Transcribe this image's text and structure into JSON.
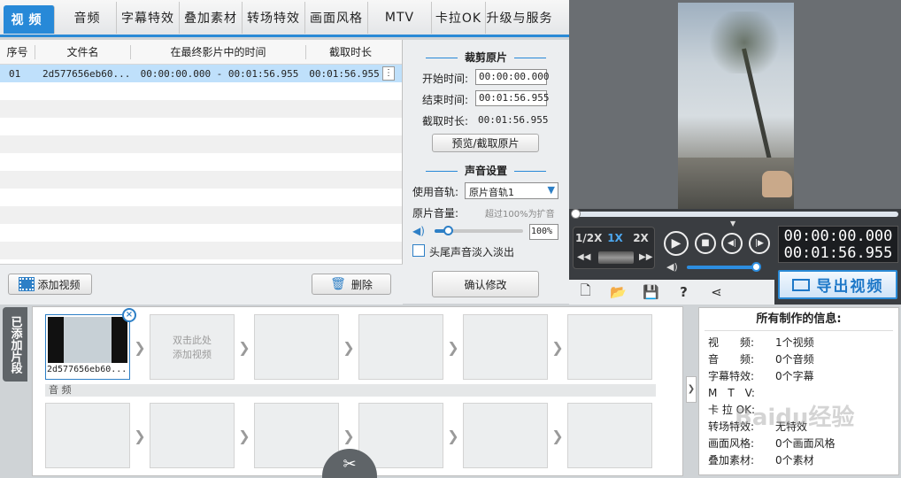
{
  "tabs": [
    "视频",
    "音频",
    "字幕特效",
    "叠加素材",
    "转场特效",
    "画面风格",
    "MTV",
    "卡拉OK",
    "升级与服务"
  ],
  "list": {
    "headers": [
      "序号",
      "文件名",
      "在最终影片中的时间",
      "截取时长"
    ],
    "rows": [
      {
        "index": "01",
        "filename": "2d577656eb60...",
        "time": "00:00:00.000 - 00:01:56.955",
        "duration": "00:01:56.955"
      }
    ],
    "add_video": "添加视频",
    "delete": "删除"
  },
  "crop": {
    "title": "裁剪原片",
    "start_label": "开始时间:",
    "start_value": "00:00:00.000",
    "end_label": "结束时间:",
    "end_value": "00:01:56.955",
    "duration_label": "截取时长:",
    "duration_value": "00:01:56.955",
    "preview_button": "预览/截取原片"
  },
  "sound": {
    "title": "声音设置",
    "track_label": "使用音轨:",
    "track_value": "原片音轨1",
    "volume_label": "原片音量:",
    "volume_hint": "超过100%为扩音",
    "volume_value": "100%",
    "fade_label": "头尾声音淡入淡出",
    "confirm_button": "确认修改"
  },
  "player": {
    "speeds": [
      "1/2X",
      "1X",
      "2X"
    ],
    "time_current": "00:00:00.000",
    "time_total": "00:01:56.955",
    "export_label": "导出视频"
  },
  "timeline": {
    "side_label": "已添加片段",
    "clip_name": "2d577656eb60...",
    "add_hint_1": "双击此处",
    "add_hint_2": "添加视频",
    "audio_label": "音 频"
  },
  "info": {
    "title": "所有制作的信息:",
    "rows": [
      {
        "k": "视　　频:",
        "v": "1个视频"
      },
      {
        "k": "音　　频:",
        "v": "0个音频"
      },
      {
        "k": "字幕特效:",
        "v": "0个字幕"
      },
      {
        "k": "M　T　V:",
        "v": ""
      },
      {
        "k": "卡 拉 OK:",
        "v": ""
      },
      {
        "k": "转场特效:",
        "v": "无特效"
      },
      {
        "k": "画面风格:",
        "v": "0个画面风格"
      },
      {
        "k": "叠加素材:",
        "v": "0个素材"
      }
    ]
  },
  "watermark": "Baidu经验",
  "colors": {
    "accent": "#2789d8",
    "selected_row": "#bfe0fb",
    "dark_panel": "#3a3d41"
  }
}
